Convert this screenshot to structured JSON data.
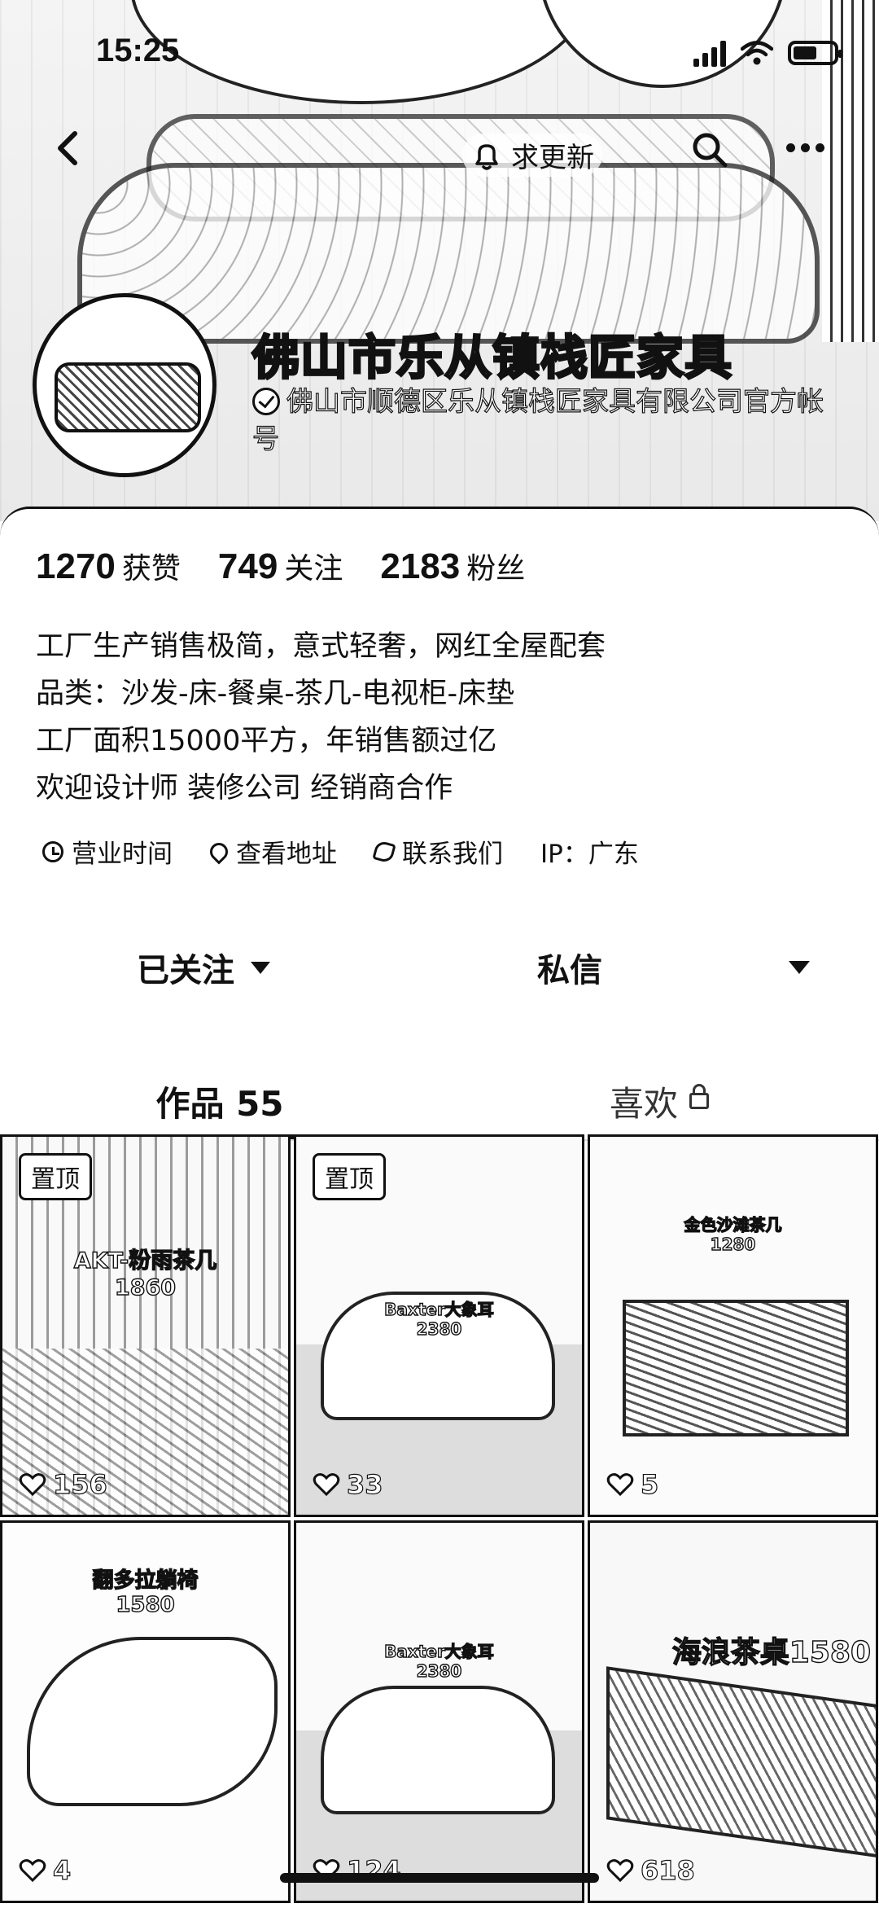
{
  "status_bar": {
    "time": "15:25"
  },
  "top_nav": {
    "update_label": "求更新"
  },
  "profile": {
    "name": "佛山市乐从镇栈匠家具",
    "verified_text": "佛山市顺德区乐从镇栈匠家具有限公司官方帐号"
  },
  "stats": [
    {
      "value": "1270",
      "label": "获赞"
    },
    {
      "value": "749",
      "label": "关注"
    },
    {
      "value": "2183",
      "label": "粉丝"
    }
  ],
  "bio": [
    "工厂生产销售极简，意式轻奢，网红全屋配套",
    "品类：沙发-床-餐桌-茶几-电视柜-床垫",
    "工厂面积15000平方，年销售额过亿",
    "欢迎设计师 装修公司 经销商合作"
  ],
  "meta": {
    "hours": "营业时间",
    "address": "查看地址",
    "contact": "联系我们",
    "ip": "IP：广东"
  },
  "actions": {
    "follow": "已关注",
    "message": "私信"
  },
  "tabs": {
    "works": "作品 55",
    "likes": "喜欢"
  },
  "works": [
    {
      "pinned": "置顶",
      "title": "AKT-粉雨茶几",
      "price": "1860",
      "likes": "156"
    },
    {
      "pinned": "置顶",
      "title": "Baxter大象耳",
      "price": "2380",
      "likes": "33"
    },
    {
      "title": "金色沙滩茶几",
      "price": "1280",
      "likes": "5"
    },
    {
      "title": "翻多拉躺椅",
      "price": "1580",
      "likes": "4"
    },
    {
      "title": "Baxter大象耳",
      "price": "2380",
      "likes": "124"
    },
    {
      "title": "海浪茶桌1580",
      "likes": "618"
    }
  ]
}
